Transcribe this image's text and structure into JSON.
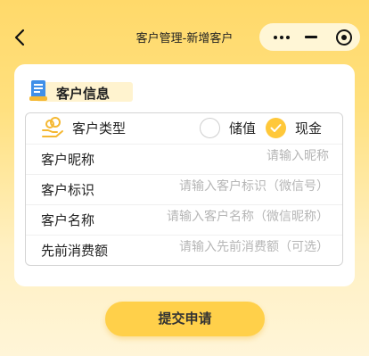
{
  "header": {
    "title": "客户管理-新增客户"
  },
  "section": {
    "title": "客户信息"
  },
  "form": {
    "customer_type": {
      "label": "客户类型",
      "options": [
        {
          "label": "储值",
          "selected": false
        },
        {
          "label": "现金",
          "selected": true
        }
      ]
    },
    "fields": [
      {
        "label": "客户昵称",
        "placeholder": "请输入昵称",
        "value": ""
      },
      {
        "label": "客户标识",
        "placeholder": "请输入客户标识（微信号）",
        "value": ""
      },
      {
        "label": "客户名称",
        "placeholder": "请输入客户名称（微信昵称）",
        "value": ""
      },
      {
        "label": "先前消费额",
        "placeholder": "请输入先前消费额（可选）",
        "value": ""
      }
    ]
  },
  "actions": {
    "submit_label": "提交申请"
  },
  "colors": {
    "accent": "#ffc83a",
    "button": "#ffd04a",
    "section_bg": "#fff3cf"
  }
}
